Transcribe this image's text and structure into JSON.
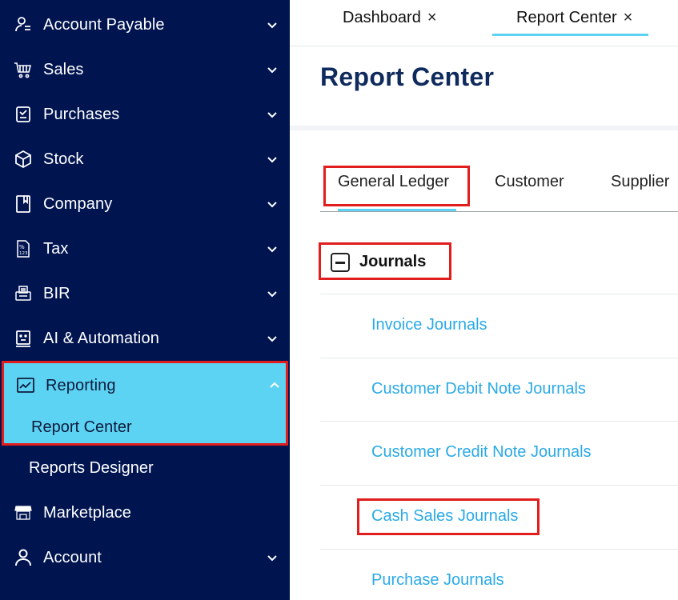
{
  "sidebar": {
    "items": [
      {
        "label": "Account Payable",
        "icon": "account-payable-icon"
      },
      {
        "label": "Sales",
        "icon": "cart-icon"
      },
      {
        "label": "Purchases",
        "icon": "receipt-icon"
      },
      {
        "label": "Stock",
        "icon": "box-icon"
      },
      {
        "label": "Company",
        "icon": "book-icon"
      },
      {
        "label": "Tax",
        "icon": "tax-icon"
      },
      {
        "label": "BIR",
        "icon": "bir-icon"
      },
      {
        "label": "AI & Automation",
        "icon": "robot-icon"
      },
      {
        "label": "Reporting",
        "icon": "chart-icon"
      }
    ],
    "reporting_sub": [
      {
        "label": "Report Center"
      },
      {
        "label": "Reports Designer"
      }
    ],
    "marketplace": {
      "label": "Marketplace",
      "icon": "store-icon"
    },
    "account": {
      "label": "Account",
      "icon": "user-icon"
    }
  },
  "tabs": [
    {
      "label": "Dashboard",
      "close": "×"
    },
    {
      "label": "Report Center",
      "close": "×"
    }
  ],
  "page": {
    "title": "Report Center"
  },
  "report_tabs": [
    {
      "label": "General Ledger"
    },
    {
      "label": "Customer"
    },
    {
      "label": "Supplier"
    }
  ],
  "journals": {
    "heading": "Journals",
    "items": [
      {
        "label": "Invoice Journals"
      },
      {
        "label": "Customer Debit Note Journals"
      },
      {
        "label": "Customer Credit Note Journals"
      },
      {
        "label": "Cash Sales Journals"
      },
      {
        "label": "Purchase Journals"
      }
    ]
  },
  "colors": {
    "sidebar_bg": "#001450",
    "accent": "#5dd3f3",
    "link": "#2aaae6",
    "highlight": "#e11d1d",
    "title": "#0f2a5c"
  }
}
